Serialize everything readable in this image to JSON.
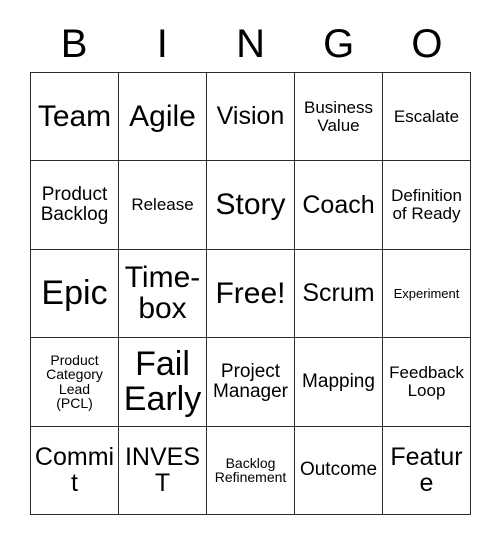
{
  "card": {
    "title": "BINGO card",
    "header_letters": [
      "B",
      "I",
      "N",
      "G",
      "O"
    ],
    "border_color": "#2b2b2b",
    "background_color": "#ffffff",
    "text_color": "#000000",
    "columns": 5,
    "rows": 5,
    "free_space_label": "Free!",
    "free_space_position": "row 3, column 3"
  },
  "grid": {
    "rows": [
      [
        {
          "text": "Team",
          "size": "lg"
        },
        {
          "text": "Agile",
          "size": "lg"
        },
        {
          "text": "Vision",
          "size": "md"
        },
        {
          "text": "Business\nValue",
          "size": "xs"
        },
        {
          "text": "Escalate",
          "size": "xs"
        }
      ],
      [
        {
          "text": "Product\nBacklog",
          "size": "sm"
        },
        {
          "text": "Release",
          "size": "xs"
        },
        {
          "text": "Story",
          "size": "lg"
        },
        {
          "text": "Coach",
          "size": "md"
        },
        {
          "text": "Definition\nof Ready",
          "size": "xs"
        }
      ],
      [
        {
          "text": "Epic",
          "size": "xl"
        },
        {
          "text": "Time-\nbox",
          "size": "lg"
        },
        {
          "text": "Free!",
          "size": "lg"
        },
        {
          "text": "Scrum",
          "size": "md"
        },
        {
          "text": "Experiment",
          "size": "tiny"
        }
      ],
      [
        {
          "text": "Product\nCategory\nLead\n(PCL)",
          "size": "xxs"
        },
        {
          "text": "Fail\nEarly",
          "size": "xl"
        },
        {
          "text": "Project\nManager",
          "size": "sm"
        },
        {
          "text": "Mapping",
          "size": "sm"
        },
        {
          "text": "Feedback\nLoop",
          "size": "xs"
        }
      ],
      [
        {
          "text": "Commit",
          "size": "md"
        },
        {
          "text": "INVEST",
          "size": "md"
        },
        {
          "text": "Backlog\nRefinement",
          "size": "xxs"
        },
        {
          "text": "Outcome",
          "size": "sm"
        },
        {
          "text": "Feature",
          "size": "md"
        }
      ]
    ]
  }
}
